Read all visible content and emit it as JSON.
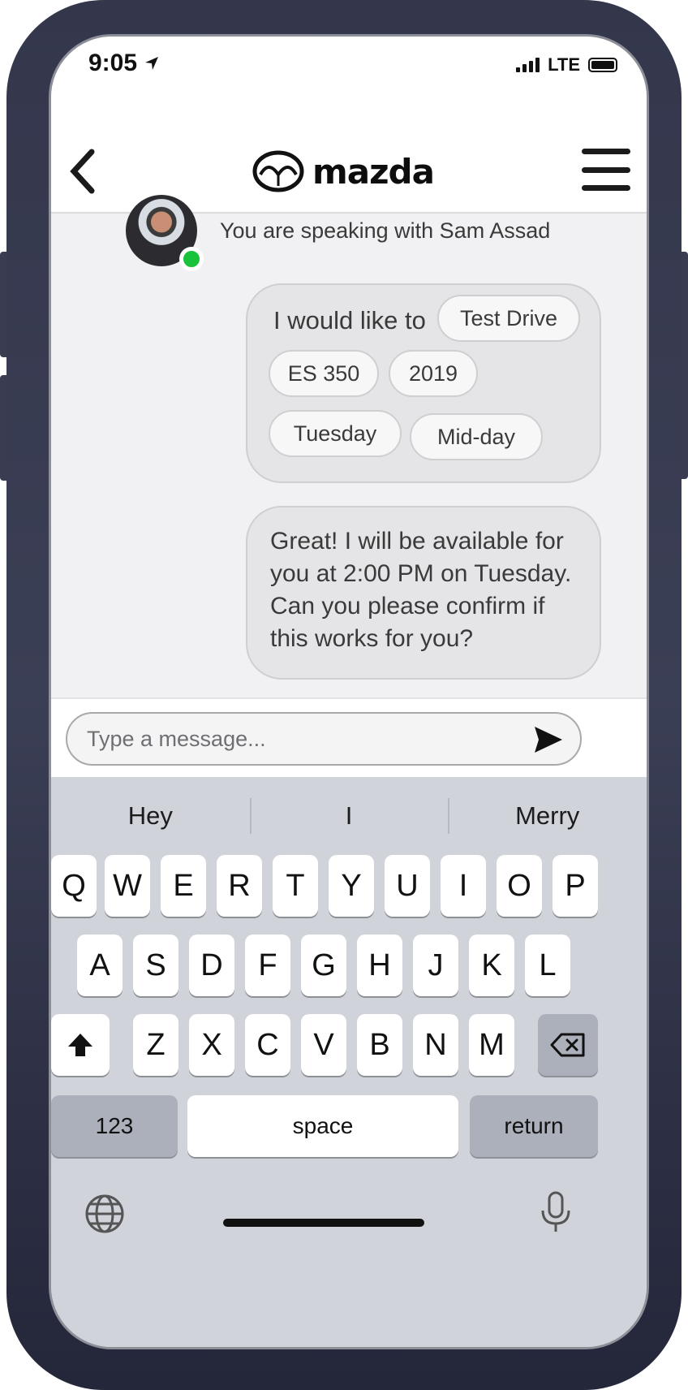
{
  "status": {
    "time": "9:05",
    "network": "LTE"
  },
  "header": {
    "brand": "mazda"
  },
  "chat": {
    "agent_line": "You are speaking with Sam Assad",
    "selection": {
      "lead": "I would like to",
      "chips": [
        "Test Drive",
        "ES 350",
        "2019",
        "Tuesday",
        "Mid-day"
      ]
    },
    "reply": "Great! I will be available for you at 2:00 PM on Tuesday. Can you please confirm if this works for you?"
  },
  "composer": {
    "placeholder": "Type a message..."
  },
  "keyboard": {
    "suggestions": [
      "Hey",
      "I",
      "Merry"
    ],
    "row1": [
      "Q",
      "W",
      "E",
      "R",
      "T",
      "Y",
      "U",
      "I",
      "O",
      "P"
    ],
    "row2": [
      "A",
      "S",
      "D",
      "F",
      "G",
      "H",
      "J",
      "K",
      "L"
    ],
    "row3": [
      "Z",
      "X",
      "C",
      "V",
      "B",
      "N",
      "M"
    ],
    "numbers_label": "123",
    "space_label": "space",
    "return_label": "return"
  },
  "colors": {
    "online": "#18c23a",
    "bubble": "#e5e5e7",
    "keyboard": "#d0d3d9"
  }
}
